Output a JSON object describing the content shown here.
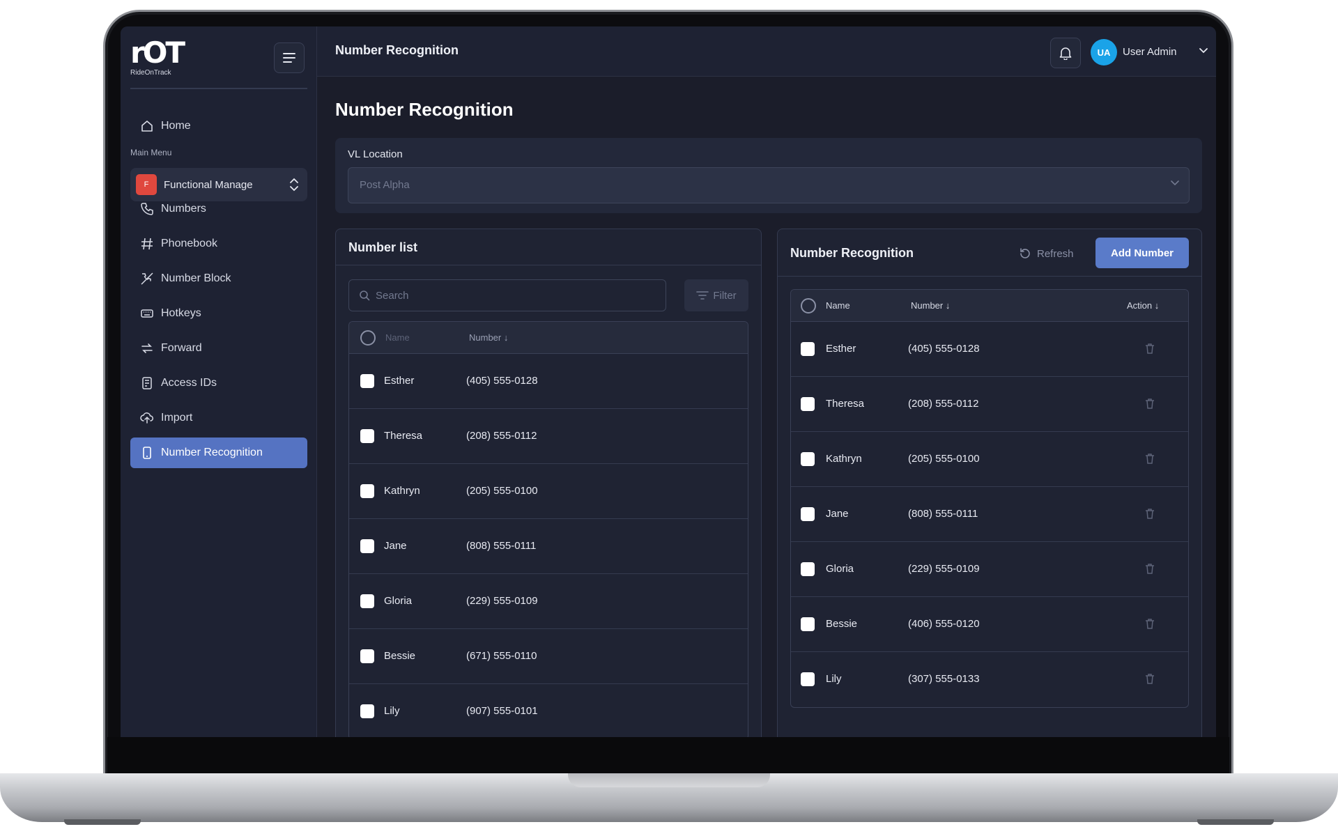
{
  "app": {
    "logo_text": "RideOnTrack",
    "logo_mark": "rOT"
  },
  "sidebar": {
    "home": "Home",
    "section_label": "Main Menu",
    "functional": {
      "badge": "F",
      "label": "Functional Manage"
    },
    "items": [
      {
        "label": "Numbers",
        "icon": "phone-icon"
      },
      {
        "label": "Phonebook",
        "icon": "hash-icon"
      },
      {
        "label": "Number Block",
        "icon": "block-icon"
      },
      {
        "label": "Hotkeys",
        "icon": "keyboard-icon"
      },
      {
        "label": "Forward",
        "icon": "forward-icon"
      },
      {
        "label": "Access IDs",
        "icon": "id-icon"
      },
      {
        "label": "Import",
        "icon": "upload-icon"
      },
      {
        "label": "Number Recognition",
        "icon": "device-icon",
        "active": true
      }
    ]
  },
  "topbar": {
    "title": "Number Recognition",
    "user_initials": "UA",
    "user_name": "User Admin"
  },
  "page": {
    "title": "Number Recognition"
  },
  "location": {
    "label": "VL Location",
    "placeholder": "Post Alpha"
  },
  "number_list": {
    "title": "Number list",
    "search_placeholder": "Search",
    "filter_label": "Filter",
    "columns": {
      "name": "Name",
      "number": "Number"
    },
    "rows": [
      {
        "name": "Esther",
        "number": "(405) 555-0128"
      },
      {
        "name": "Theresa",
        "number": "(208) 555-0112"
      },
      {
        "name": "Kathryn",
        "number": "(205) 555-0100"
      },
      {
        "name": "Jane",
        "number": "(808) 555-0111"
      },
      {
        "name": "Gloria",
        "number": "(229) 555-0109"
      },
      {
        "name": "Bessie",
        "number": "(671) 555-0110"
      },
      {
        "name": "Lily",
        "number": "(907) 555-0101"
      }
    ]
  },
  "recognition": {
    "title": "Number Recognition",
    "refresh_label": "Refresh",
    "add_label": "Add Number",
    "columns": {
      "name": "Name",
      "number": "Number",
      "action": "Action"
    },
    "rows": [
      {
        "name": "Esther",
        "number": "(405) 555-0128"
      },
      {
        "name": "Theresa",
        "number": "(208) 555-0112"
      },
      {
        "name": "Kathryn",
        "number": "(205) 555-0100"
      },
      {
        "name": "Jane",
        "number": "(808) 555-0111"
      },
      {
        "name": "Gloria",
        "number": "(229) 555-0109"
      },
      {
        "name": "Bessie",
        "number": "(406) 555-0120"
      },
      {
        "name": "Lily",
        "number": "(307) 555-0133"
      }
    ]
  },
  "colors": {
    "accent": "#5573c2",
    "background": "#1b1d2a",
    "avatar": "#1aa3e8",
    "badge": "#e0483e"
  }
}
